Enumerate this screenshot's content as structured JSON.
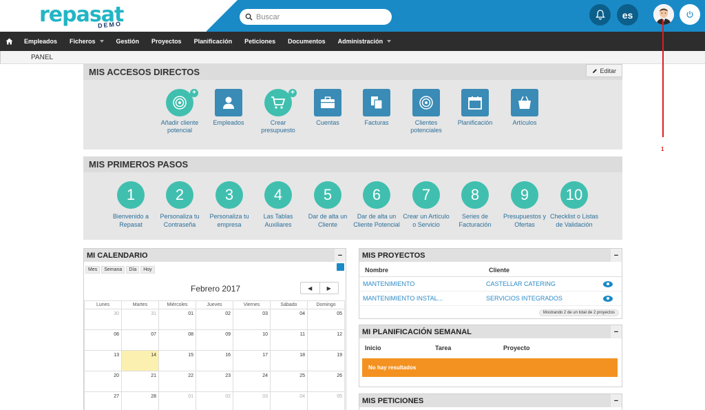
{
  "header": {
    "logo": "repasat",
    "logo_sub": "DEMO",
    "search_placeholder": "Buscar",
    "lang": "es",
    "colors": {
      "topbar": "#1a8ac7",
      "teal": "#40bfaf",
      "orange": "#f39221"
    }
  },
  "nav": {
    "home_icon": "home-icon",
    "items": [
      {
        "label": "Empleados",
        "dropdown": false
      },
      {
        "label": "Ficheros",
        "dropdown": true
      },
      {
        "label": "Gestión",
        "dropdown": false
      },
      {
        "label": "Proyectos",
        "dropdown": false
      },
      {
        "label": "Planificación",
        "dropdown": false
      },
      {
        "label": "Peticiones",
        "dropdown": false
      },
      {
        "label": "Documentos",
        "dropdown": false
      },
      {
        "label": "Administración",
        "dropdown": true
      }
    ]
  },
  "breadcrumb": "PANEL",
  "accesos": {
    "title": "MIS ACCESOS DIRECTOS",
    "edit": "Editar",
    "items": [
      {
        "label": "Añadir cliente potencial",
        "icon": "target-icon"
      },
      {
        "label": "Empleados",
        "icon": "user-icon"
      },
      {
        "label": "Crear presupuesto",
        "icon": "cart-icon"
      },
      {
        "label": "Cuentas",
        "icon": "briefcase-icon"
      },
      {
        "label": "Facturas",
        "icon": "documents-icon"
      },
      {
        "label": "Clientes potenciales",
        "icon": "target-icon"
      },
      {
        "label": "Planificación",
        "icon": "calendar-icon"
      },
      {
        "label": "Artículos",
        "icon": "basket-icon"
      }
    ]
  },
  "pasos": {
    "title": "MIS PRIMEROS PASOS",
    "items": [
      {
        "num": "1",
        "label": "Bienvenido a Repasat"
      },
      {
        "num": "2",
        "label": "Personaliza tu Contraseña"
      },
      {
        "num": "3",
        "label": "Personaliza tu empresa"
      },
      {
        "num": "4",
        "label": "Las Tablas Auxiliares"
      },
      {
        "num": "5",
        "label": "Dar de alta un Cliente"
      },
      {
        "num": "6",
        "label": "Dar de alta un Cliente Potencial"
      },
      {
        "num": "7",
        "label": "Crear un Artículo o Servicio"
      },
      {
        "num": "8",
        "label": "Series de Facturación"
      },
      {
        "num": "9",
        "label": "Presupuestos y Ofertas"
      },
      {
        "num": "10",
        "label": "Checklist o Listas de Validación"
      }
    ]
  },
  "calendario": {
    "title": "MI CALENDARIO",
    "collapse": "−",
    "views": [
      "Mes",
      "Semana",
      "Día",
      "Hoy"
    ],
    "month": "Febrero 2017",
    "prev": "◀",
    "next": "▶",
    "days": [
      "Lunes",
      "Martes",
      "Miércoles",
      "Jueves",
      "Viernes",
      "Sábado",
      "Domingo"
    ],
    "weeks": [
      [
        "30",
        "31",
        "01",
        "02",
        "03",
        "04",
        "05"
      ],
      [
        "06",
        "07",
        "08",
        "09",
        "10",
        "11",
        "12"
      ],
      [
        "13",
        "14",
        "15",
        "16",
        "17",
        "18",
        "19"
      ],
      [
        "20",
        "21",
        "22",
        "23",
        "24",
        "25",
        "26"
      ],
      [
        "27",
        "28",
        "01",
        "02",
        "03",
        "04",
        "05"
      ]
    ],
    "today": "14"
  },
  "proyectos": {
    "title": "MIS PROYECTOS",
    "collapse": "−",
    "col_nombre": "Nombre",
    "col_cliente": "Cliente",
    "rows": [
      {
        "nombre": "MANTENIMIENTO",
        "cliente": "CASTELLAR CATERING"
      },
      {
        "nombre": "MANTENIMIENTO INSTAL...",
        "cliente": "SERVICIOS INTEGRADOS"
      }
    ],
    "pager": "Mostrando 2 de un total de 2 proyectos"
  },
  "planificacion": {
    "title": "MI PLANIFICACIÓN SEMANAL",
    "collapse": "−",
    "cols": [
      "Inicio",
      "Tarea",
      "Proyecto"
    ],
    "empty": "No hay resultados"
  },
  "peticiones": {
    "title": "MIS PETICIONES",
    "collapse": "−"
  },
  "annotation": "1"
}
